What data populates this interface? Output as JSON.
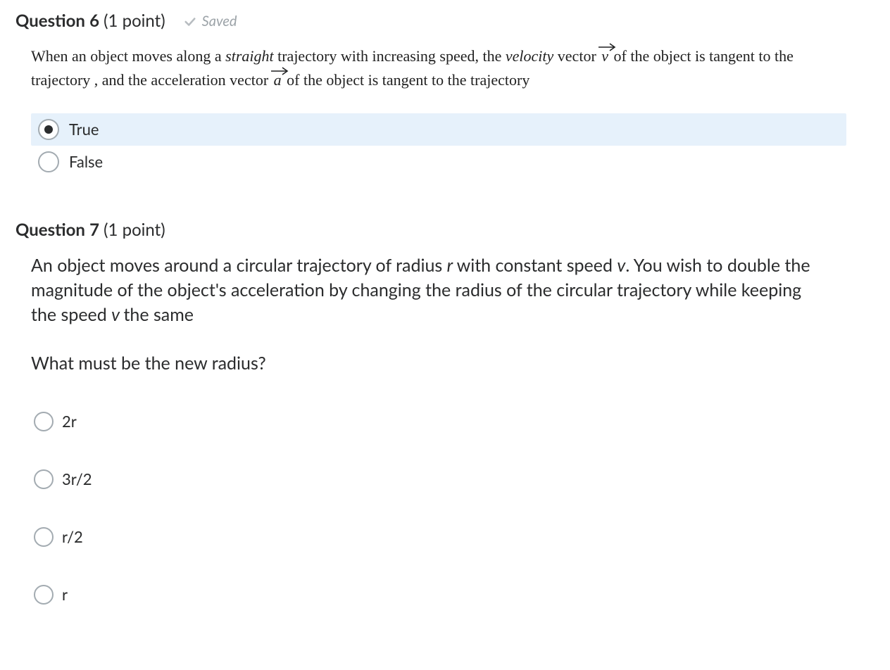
{
  "q6": {
    "header": {
      "qword": "Question",
      "number": "6",
      "points": "(1 point)"
    },
    "saved": {
      "label": "Saved"
    },
    "text": {
      "pre1": "When an object moves along a ",
      "straight": "straight",
      "mid1": " trajectory with increasing speed, the ",
      "velocity_it": "velocity",
      "mid2": " vector ",
      "v": "v",
      "mid3": " of the object is tangent to the trajectory , and the acceleration vector ",
      "a": "a",
      "mid4": "  of the object is tangent to the trajectory"
    },
    "options": {
      "true_label": "True",
      "false_label": "False",
      "selected": "true"
    }
  },
  "q7": {
    "header": {
      "qword": "Question",
      "number": "7",
      "points": "(1 point)"
    },
    "text": {
      "p1a": "An object moves around a circular trajectory of radius ",
      "r1": "r ",
      "p1b": "with constant speed ",
      "v1": "v",
      "p1c": ". You wish to double the magnitude of the object's acceleration by changing the radius of the circular trajectory while keeping the speed ",
      "v2": "v ",
      "p1d": "the same"
    },
    "sub": "What must be the new radius?",
    "options": [
      {
        "label": "2r"
      },
      {
        "label": "3r/2"
      },
      {
        "label": "r/2"
      },
      {
        "label": "r"
      }
    ]
  }
}
